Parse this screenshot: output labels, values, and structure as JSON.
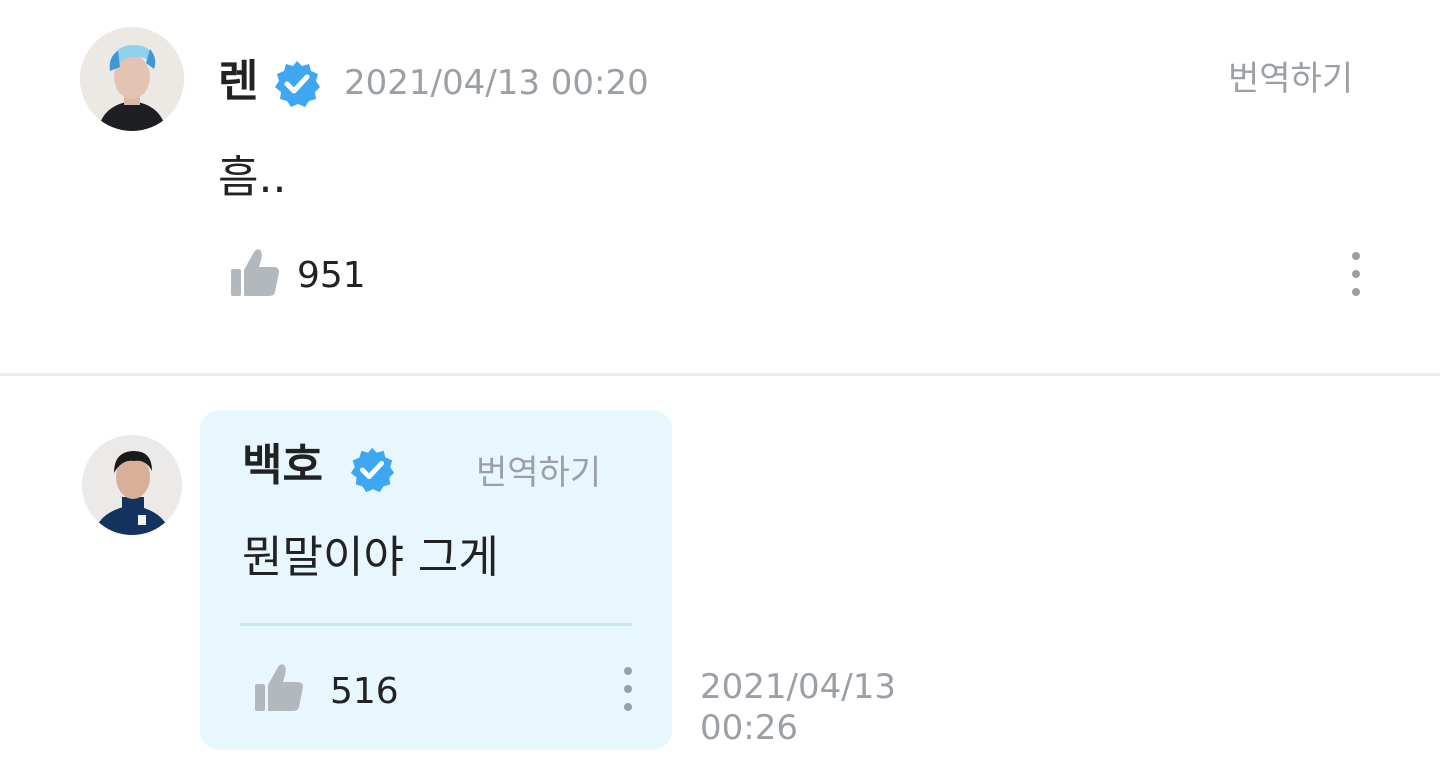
{
  "post": {
    "author": "렌",
    "verified_icon": "verified-badge-icon",
    "timestamp": "2021/04/13 00:20",
    "translate_label": "번역하기",
    "text": "흠..",
    "likes": "951",
    "like_icon": "thumbs-up-icon",
    "more_icon": "more-vertical-icon"
  },
  "reply": {
    "author": "백호",
    "verified_icon": "verified-badge-icon",
    "translate_label": "번역하기",
    "text": "뭔말이야 그게",
    "likes": "516",
    "like_icon": "thumbs-up-icon",
    "more_icon": "more-vertical-icon",
    "date": "2021/04/13",
    "time": "00:26"
  },
  "colors": {
    "verified": "#3da7f2",
    "muted": "#9ba0a6",
    "reply_bg": "#e8f6fd",
    "divider": "#e6eef3"
  }
}
